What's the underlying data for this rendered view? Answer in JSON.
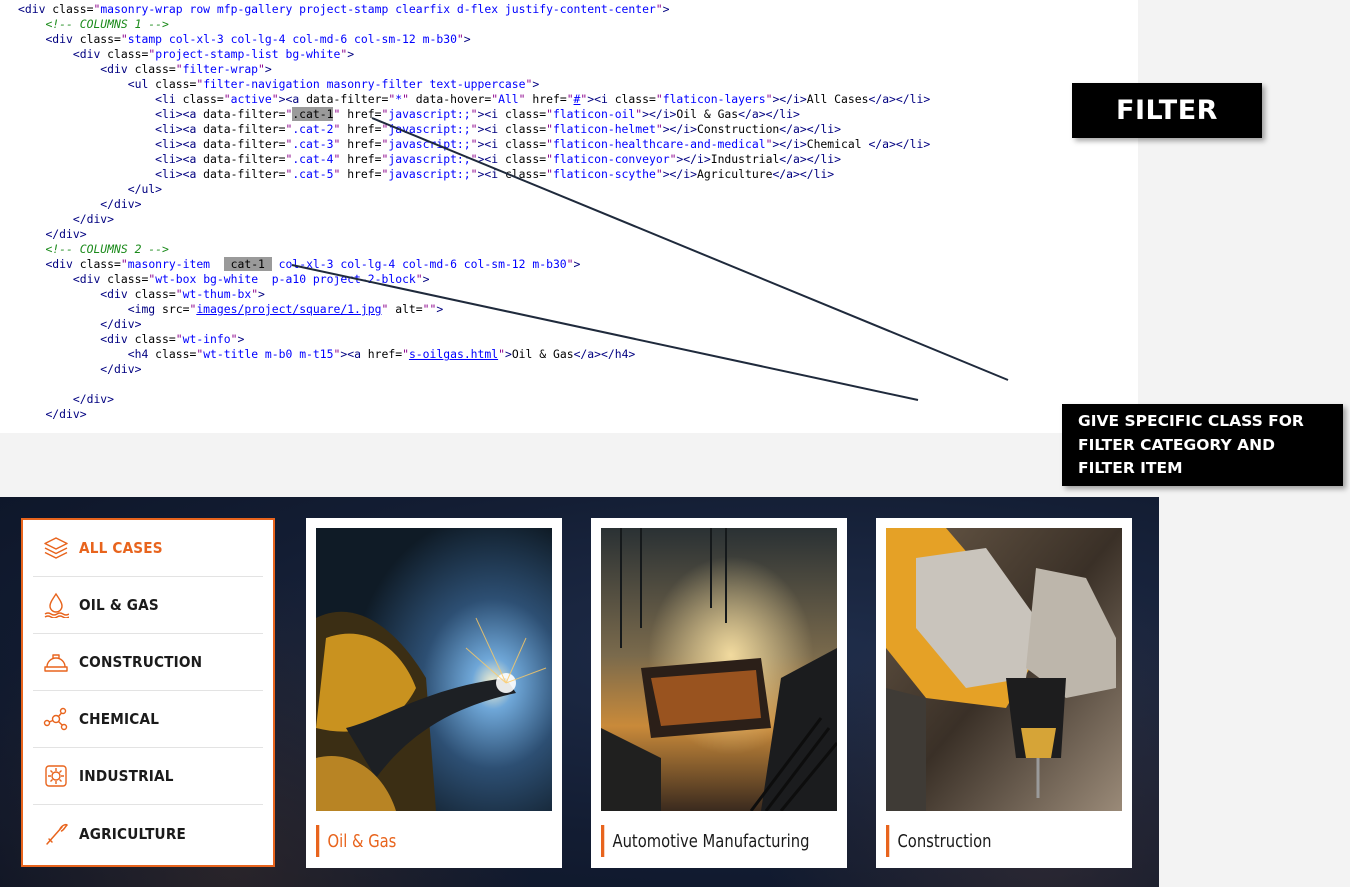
{
  "code_lines": [
    {
      "parts": [
        [
          "tag",
          "<div "
        ],
        [
          "attr",
          "class="
        ],
        [
          "str",
          "\""
        ],
        [
          "val",
          "masonry-wrap row mfp-gallery project-stamp clearfix d-flex justify-content-center"
        ],
        [
          "str",
          "\""
        ],
        [
          "tag",
          ">"
        ]
      ]
    },
    {
      "parts": [
        [
          "txt",
          "    "
        ],
        [
          "cmt",
          "<!-- COLUMNS 1 -->"
        ]
      ]
    },
    {
      "parts": [
        [
          "txt",
          "    "
        ],
        [
          "tag",
          "<div "
        ],
        [
          "attr",
          "class="
        ],
        [
          "str",
          "\""
        ],
        [
          "val",
          "stamp col-xl-3 col-lg-4 col-md-6 col-sm-12 m-b30"
        ],
        [
          "str",
          "\""
        ],
        [
          "tag",
          ">"
        ]
      ]
    },
    {
      "parts": [
        [
          "txt",
          "        "
        ],
        [
          "tag",
          "<div "
        ],
        [
          "attr",
          "class="
        ],
        [
          "str",
          "\""
        ],
        [
          "val",
          "project-stamp-list bg-white"
        ],
        [
          "str",
          "\""
        ],
        [
          "tag",
          ">"
        ]
      ]
    },
    {
      "parts": [
        [
          "txt",
          "            "
        ],
        [
          "tag",
          "<div "
        ],
        [
          "attr",
          "class="
        ],
        [
          "str",
          "\""
        ],
        [
          "val",
          "filter-wrap"
        ],
        [
          "str",
          "\""
        ],
        [
          "tag",
          ">"
        ]
      ]
    },
    {
      "parts": [
        [
          "txt",
          "                "
        ],
        [
          "tag",
          "<ul "
        ],
        [
          "attr",
          "class="
        ],
        [
          "str",
          "\""
        ],
        [
          "val",
          "filter-navigation masonry-filter text-uppercase"
        ],
        [
          "str",
          "\""
        ],
        [
          "tag",
          ">"
        ]
      ]
    },
    {
      "parts": [
        [
          "txt",
          "                    "
        ],
        [
          "tag",
          "<li "
        ],
        [
          "attr",
          "class="
        ],
        [
          "str",
          "\""
        ],
        [
          "val",
          "active"
        ],
        [
          "str",
          "\""
        ],
        [
          "tag",
          "><a "
        ],
        [
          "attr",
          "data-filter="
        ],
        [
          "str",
          "\""
        ],
        [
          "val",
          "*"
        ],
        [
          "str",
          "\""
        ],
        [
          "attr",
          " data-hover="
        ],
        [
          "str",
          "\""
        ],
        [
          "val",
          "All"
        ],
        [
          "str",
          "\""
        ],
        [
          "attr",
          " href="
        ],
        [
          "str",
          "\""
        ],
        [
          "link",
          "#"
        ],
        [
          "str",
          "\""
        ],
        [
          "tag",
          "><i "
        ],
        [
          "attr",
          "class="
        ],
        [
          "str",
          "\""
        ],
        [
          "val",
          "flaticon-layers"
        ],
        [
          "str",
          "\""
        ],
        [
          "tag",
          "></i>"
        ],
        [
          "txt",
          "All Cases"
        ],
        [
          "tag",
          "</a></li>"
        ]
      ]
    },
    {
      "parts": [
        [
          "txt",
          "                    "
        ],
        [
          "tag",
          "<li><a "
        ],
        [
          "attr",
          "data-filter="
        ],
        [
          "str",
          "\""
        ],
        [
          "hl",
          ".cat-1"
        ],
        [
          "str",
          "\""
        ],
        [
          "attr",
          " href="
        ],
        [
          "str",
          "\""
        ],
        [
          "val",
          "javascript:;"
        ],
        [
          "str",
          "\""
        ],
        [
          "tag",
          "><i "
        ],
        [
          "attr",
          "class="
        ],
        [
          "str",
          "\""
        ],
        [
          "val",
          "flaticon-oil"
        ],
        [
          "str",
          "\""
        ],
        [
          "tag",
          "></i>"
        ],
        [
          "txt",
          "Oil & Gas"
        ],
        [
          "tag",
          "</a></li>"
        ]
      ]
    },
    {
      "parts": [
        [
          "txt",
          "                    "
        ],
        [
          "tag",
          "<li><a "
        ],
        [
          "attr",
          "data-filter="
        ],
        [
          "str",
          "\""
        ],
        [
          "val",
          ".cat-2"
        ],
        [
          "str",
          "\""
        ],
        [
          "attr",
          " href="
        ],
        [
          "str",
          "\""
        ],
        [
          "val",
          "javascript:;"
        ],
        [
          "str",
          "\""
        ],
        [
          "tag",
          "><i "
        ],
        [
          "attr",
          "class="
        ],
        [
          "str",
          "\""
        ],
        [
          "val",
          "flaticon-helmet"
        ],
        [
          "str",
          "\""
        ],
        [
          "tag",
          "></i>"
        ],
        [
          "txt",
          "Construction"
        ],
        [
          "tag",
          "</a></li>"
        ]
      ]
    },
    {
      "parts": [
        [
          "txt",
          "                    "
        ],
        [
          "tag",
          "<li><a "
        ],
        [
          "attr",
          "data-filter="
        ],
        [
          "str",
          "\""
        ],
        [
          "val",
          ".cat-3"
        ],
        [
          "str",
          "\""
        ],
        [
          "attr",
          " href="
        ],
        [
          "str",
          "\""
        ],
        [
          "val",
          "javascript:;"
        ],
        [
          "str",
          "\""
        ],
        [
          "tag",
          "><i "
        ],
        [
          "attr",
          "class="
        ],
        [
          "str",
          "\""
        ],
        [
          "val",
          "flaticon-healthcare-and-medical"
        ],
        [
          "str",
          "\""
        ],
        [
          "tag",
          "></i>"
        ],
        [
          "txt",
          "Chemical "
        ],
        [
          "tag",
          "</a></li>"
        ]
      ]
    },
    {
      "parts": [
        [
          "txt",
          "                    "
        ],
        [
          "tag",
          "<li><a "
        ],
        [
          "attr",
          "data-filter="
        ],
        [
          "str",
          "\""
        ],
        [
          "val",
          ".cat-4"
        ],
        [
          "str",
          "\""
        ],
        [
          "attr",
          " href="
        ],
        [
          "str",
          "\""
        ],
        [
          "val",
          "javascript:;"
        ],
        [
          "str",
          "\""
        ],
        [
          "tag",
          "><i "
        ],
        [
          "attr",
          "class="
        ],
        [
          "str",
          "\""
        ],
        [
          "val",
          "flaticon-conveyor"
        ],
        [
          "str",
          "\""
        ],
        [
          "tag",
          "></i>"
        ],
        [
          "txt",
          "Industrial"
        ],
        [
          "tag",
          "</a></li>"
        ]
      ]
    },
    {
      "parts": [
        [
          "txt",
          "                    "
        ],
        [
          "tag",
          "<li><a "
        ],
        [
          "attr",
          "data-filter="
        ],
        [
          "str",
          "\""
        ],
        [
          "val",
          ".cat-5"
        ],
        [
          "str",
          "\""
        ],
        [
          "attr",
          " href="
        ],
        [
          "str",
          "\""
        ],
        [
          "val",
          "javascript:;"
        ],
        [
          "str",
          "\""
        ],
        [
          "tag",
          "><i "
        ],
        [
          "attr",
          "class="
        ],
        [
          "str",
          "\""
        ],
        [
          "val",
          "flaticon-scythe"
        ],
        [
          "str",
          "\""
        ],
        [
          "tag",
          "></i>"
        ],
        [
          "txt",
          "Agriculture"
        ],
        [
          "tag",
          "</a></li>"
        ]
      ]
    },
    {
      "parts": [
        [
          "txt",
          "                "
        ],
        [
          "tag",
          "</ul>"
        ]
      ]
    },
    {
      "parts": [
        [
          "txt",
          "            "
        ],
        [
          "tag",
          "</div>"
        ]
      ]
    },
    {
      "parts": [
        [
          "txt",
          "        "
        ],
        [
          "tag",
          "</div>"
        ]
      ]
    },
    {
      "parts": [
        [
          "txt",
          "    "
        ],
        [
          "tag",
          "</div>"
        ]
      ]
    },
    {
      "parts": [
        [
          "txt",
          "    "
        ],
        [
          "cmt",
          "<!-- COLUMNS 2 -->"
        ]
      ]
    },
    {
      "parts": [
        [
          "txt",
          "    "
        ],
        [
          "tag",
          "<div "
        ],
        [
          "attr",
          "class="
        ],
        [
          "str",
          "\""
        ],
        [
          "val",
          "masonry-item  "
        ],
        [
          "hl",
          " cat-1 "
        ],
        [
          "val",
          " col-xl-3 col-lg-4 col-md-6 col-sm-12 m-b30"
        ],
        [
          "str",
          "\""
        ],
        [
          "tag",
          ">"
        ]
      ]
    },
    {
      "parts": [
        [
          "txt",
          "        "
        ],
        [
          "tag",
          "<div "
        ],
        [
          "attr",
          "class="
        ],
        [
          "str",
          "\""
        ],
        [
          "val",
          "wt-box bg-white  p-a10 project-2-block"
        ],
        [
          "str",
          "\""
        ],
        [
          "tag",
          ">"
        ]
      ]
    },
    {
      "parts": [
        [
          "txt",
          "            "
        ],
        [
          "tag",
          "<div "
        ],
        [
          "attr",
          "class="
        ],
        [
          "str",
          "\""
        ],
        [
          "val",
          "wt-thum-bx"
        ],
        [
          "str",
          "\""
        ],
        [
          "tag",
          ">"
        ]
      ]
    },
    {
      "parts": [
        [
          "txt",
          "                "
        ],
        [
          "tag",
          "<img "
        ],
        [
          "attr",
          "src="
        ],
        [
          "str",
          "\""
        ],
        [
          "link",
          "images/project/square/1.jpg"
        ],
        [
          "str",
          "\""
        ],
        [
          "attr",
          " alt="
        ],
        [
          "str",
          "\"\""
        ],
        [
          "tag",
          ">"
        ]
      ]
    },
    {
      "parts": [
        [
          "txt",
          "            "
        ],
        [
          "tag",
          "</div>"
        ]
      ]
    },
    {
      "parts": [
        [
          "txt",
          "            "
        ],
        [
          "tag",
          "<div "
        ],
        [
          "attr",
          "class="
        ],
        [
          "str",
          "\""
        ],
        [
          "val",
          "wt-info"
        ],
        [
          "str",
          "\""
        ],
        [
          "tag",
          ">"
        ]
      ]
    },
    {
      "parts": [
        [
          "txt",
          "                "
        ],
        [
          "tag",
          "<h4 "
        ],
        [
          "attr",
          "class="
        ],
        [
          "str",
          "\""
        ],
        [
          "val",
          "wt-title m-b0 m-t15"
        ],
        [
          "str",
          "\""
        ],
        [
          "tag",
          "><a "
        ],
        [
          "attr",
          "href="
        ],
        [
          "str",
          "\""
        ],
        [
          "link",
          "s-oilgas.html"
        ],
        [
          "str",
          "\""
        ],
        [
          "tag",
          ">"
        ],
        [
          "txt",
          "Oil & Gas"
        ],
        [
          "tag",
          "</a></h4>"
        ]
      ]
    },
    {
      "parts": [
        [
          "txt",
          "            "
        ],
        [
          "tag",
          "</div>"
        ]
      ]
    },
    {
      "parts": [
        [
          "txt",
          ""
        ]
      ]
    },
    {
      "parts": [
        [
          "txt",
          "        "
        ],
        [
          "tag",
          "</div>"
        ]
      ]
    },
    {
      "parts": [
        [
          "txt",
          "    "
        ],
        [
          "tag",
          "</div>"
        ]
      ]
    }
  ],
  "callouts": {
    "filter": "FILTER",
    "specific_class": "GIVE SPECIFIC CLASS FOR FILTER CATEGORY AND FILTER ITEM"
  },
  "filter_nav": [
    {
      "label": "All Cases",
      "icon": "layers-icon",
      "active": true
    },
    {
      "label": "Oil & Gas",
      "icon": "oil-icon",
      "active": false
    },
    {
      "label": "Construction",
      "icon": "helmet-icon",
      "active": false
    },
    {
      "label": "Chemical",
      "icon": "molecule-icon",
      "active": false
    },
    {
      "label": "Industrial",
      "icon": "conveyor-icon",
      "active": false
    },
    {
      "label": "Agriculture",
      "icon": "scythe-icon",
      "active": false
    }
  ],
  "cards": [
    {
      "title": "Oil & Gas",
      "image": "welding-photo",
      "accent": true
    },
    {
      "title": "Automotive Manufacturing",
      "image": "steel-mill-photo",
      "accent": false
    },
    {
      "title": "Construction",
      "image": "gloved-drill-photo",
      "accent": false
    }
  ],
  "colors": {
    "accent": "#e8641d",
    "site_background": "#131d33",
    "callout_background": "#000000"
  }
}
